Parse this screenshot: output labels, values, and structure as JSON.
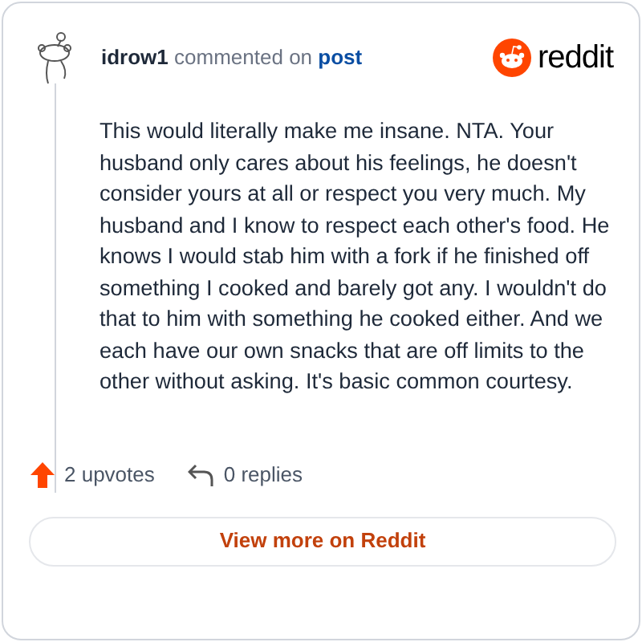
{
  "comment": {
    "author": "idrow1",
    "action": "commented on",
    "link": "post",
    "brand": "reddit",
    "body": "This would literally make me insane. NTA. Your husband only cares about his feelings, he doesn't consider yours at all or respect you very much. My husband and I know to respect each other's food. He knows I would stab him with a fork if he finished off something I cooked and barely got any. I wouldn't do that to him with something he cooked either. And we each have our own snacks that are off limits to the other without asking. It's basic common courtesy.",
    "upvotes": "2 upvotes",
    "replies": "0 replies"
  },
  "button": "View more on Reddit"
}
